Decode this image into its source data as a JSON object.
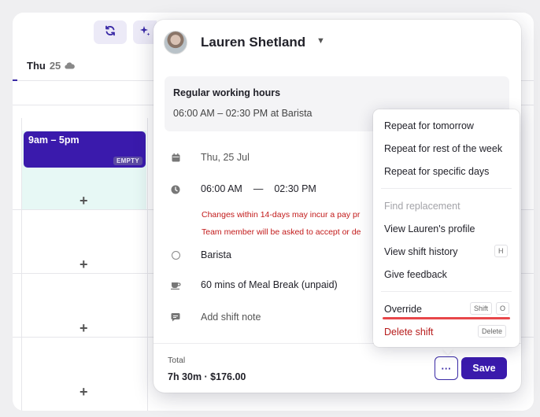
{
  "calendar": {
    "day_name": "Thu",
    "day_number": "25",
    "shift_time": "9am – 5pm",
    "shift_badge": "EMPTY",
    "add_label": "+"
  },
  "toolbar": {
    "refresh_icon": "refresh-icon",
    "sparkle_icon": "sparkle-icon"
  },
  "panel": {
    "person_name": "Lauren Shetland",
    "working_hours": {
      "title": "Regular working hours",
      "value": "06:00 AM  –  02:30 PM at Barista"
    },
    "date": "Thu, 25 Jul",
    "start_time": "06:00 AM",
    "time_separator": "—",
    "end_time": "02:30 PM",
    "warning_1": "Changes within 14-days may incur a pay pr",
    "warning_2": "Team member will be asked to accept or de",
    "position": "Barista",
    "meal_break": "60 mins of Meal Break (unpaid)",
    "shift_note_placeholder": "Add shift note",
    "total_label": "Total",
    "total_value": "7h 30m · $176.00",
    "more_label": "···",
    "save_label": "Save"
  },
  "menu": {
    "items": [
      {
        "label": "Repeat for tomorrow"
      },
      {
        "label": "Repeat for rest of the week"
      },
      {
        "label": "Repeat for specific days"
      },
      {
        "label": "Find replacement"
      },
      {
        "label": "View Lauren's profile"
      },
      {
        "label": "View shift history",
        "shortcut": "H"
      },
      {
        "label": "Give feedback"
      },
      {
        "label": "Override",
        "shortcut_mod": "Shift",
        "shortcut": "O"
      },
      {
        "label": "Delete shift",
        "shortcut": "Delete"
      }
    ]
  },
  "colors": {
    "brand": "#3a1aac",
    "danger": "#b71c1c",
    "warning_text": "#c21a1a",
    "highlight_underline": "#e8474a"
  }
}
